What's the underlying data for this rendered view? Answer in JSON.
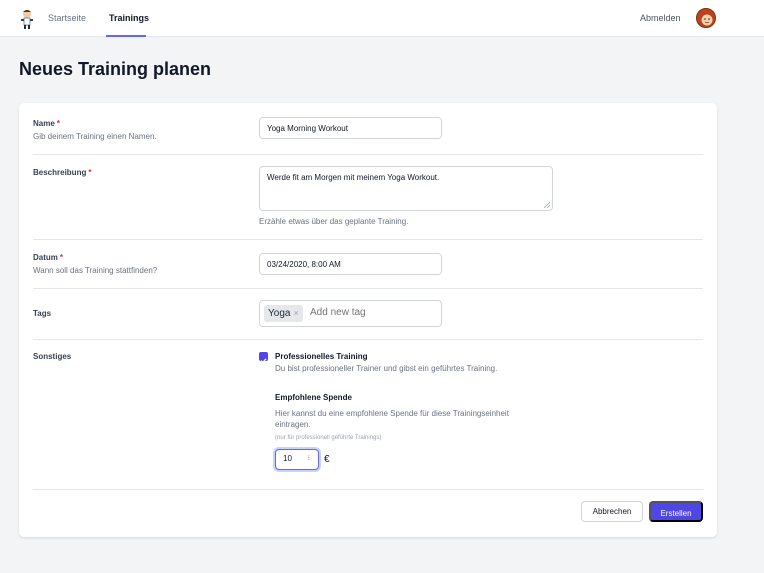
{
  "nav": {
    "home": "Startseite",
    "trainings": "Trainings",
    "logout": "Abmelden"
  },
  "page_title": "Neues Training planen",
  "form": {
    "name": {
      "label": "Name",
      "required_mark": "*",
      "hint": "Gib deinem Training einen Namen.",
      "value": "Yoga Morning Workout"
    },
    "description": {
      "label": "Beschreibung",
      "required_mark": "*",
      "value": "Werde fit am Morgen mit meinem Yoga Workout.",
      "help": "Erzähle etwas über das geplante Training."
    },
    "date": {
      "label": "Datum",
      "required_mark": "*",
      "hint": "Wann soll das Training stattfinden?",
      "value": "03/24/2020, 8:00 AM"
    },
    "tags": {
      "label": "Tags",
      "items": [
        "Yoga"
      ],
      "remove_glyph": "×",
      "placeholder": "Add new tag"
    },
    "other": {
      "label": "Sonstiges",
      "professional_label": "Professionelles Training",
      "professional_help": "Du bist professioneller Trainer und gibst ein geführtes Training.",
      "professional_checked": true,
      "donation_title": "Empfohlene Spende",
      "donation_desc": "Hier kannst du eine empfohlene Spende für diese Trainingseinheit eintragen.",
      "donation_note": "(nur für professionell geführte Trainings)",
      "donation_value": "10",
      "spinner_glyph": "⁝",
      "currency": "€"
    }
  },
  "buttons": {
    "cancel": "Abbrechen",
    "submit": "Erstellen"
  },
  "colors": {
    "accent": "#4f46e5",
    "required": "#dc2626"
  }
}
